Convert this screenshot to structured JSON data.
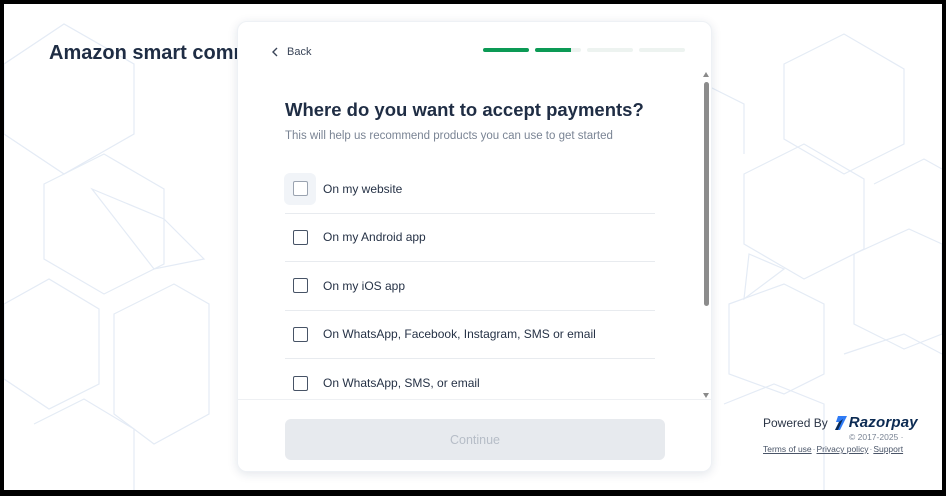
{
  "page": {
    "title": "Amazon smart comm"
  },
  "modal": {
    "back_label": "Back",
    "progress": {
      "total_steps": 4,
      "current_fraction": 1.75
    },
    "heading": "Where do you want to accept payments?",
    "subheading": "This will help us recommend products you can use to get started",
    "options": [
      {
        "label": "On my website",
        "checked": false
      },
      {
        "label": "On my Android app",
        "checked": false
      },
      {
        "label": "On my iOS app",
        "checked": false
      },
      {
        "label": "On WhatsApp, Facebook, Instagram, SMS or email",
        "checked": false
      },
      {
        "label": "On WhatsApp, SMS, or email",
        "checked": false
      }
    ],
    "continue_label": "Continue",
    "continue_enabled": false
  },
  "branding": {
    "powered_by": "Powered By",
    "brand": "Razorpay",
    "copyright": "© 2017-2025 ·",
    "links": {
      "terms": "Terms of use",
      "privacy": "Privacy policy",
      "support": "Support"
    }
  },
  "colors": {
    "accent_green": "#0c9a55",
    "title": "#1f2d44",
    "brand_navy": "#0b2a52",
    "pattern_line": "#e4ebf5"
  },
  "icons": {
    "back": "chevron-left-icon",
    "brand": "razorpay-logo-icon"
  }
}
